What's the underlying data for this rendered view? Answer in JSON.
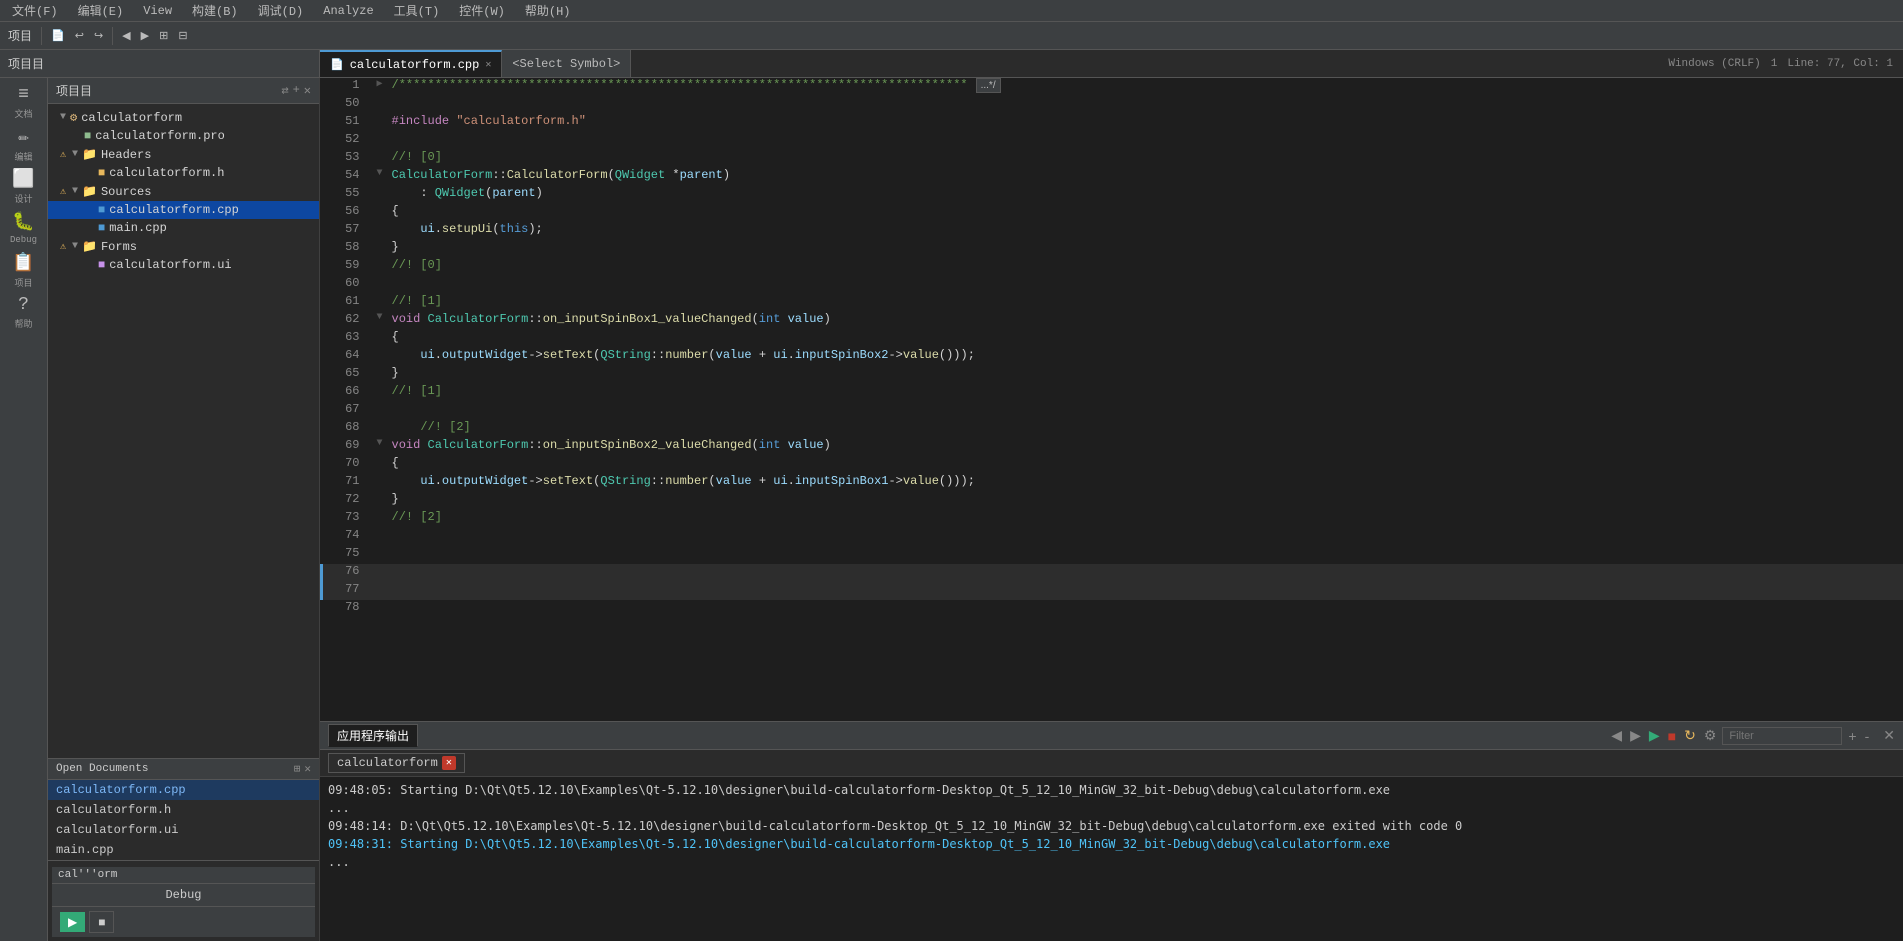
{
  "menu": {
    "items": [
      "文件(F)",
      "编辑(E)",
      "View",
      "构建(B)",
      "调试(D)",
      "Analyze",
      "工具(T)",
      "控件(W)",
      "帮助(H)"
    ]
  },
  "toolbar": {
    "project_label": "项目",
    "file_icon": "📄",
    "undo": "↩",
    "redo": "↪",
    "nav_back": "◀",
    "nav_fwd": "▶",
    "zoom_add": "⊞",
    "zoom_sub": "⊟"
  },
  "tabs": {
    "active_file": "calculatorform.cpp",
    "symbol": "<Select Symbol>",
    "breadcrumb": "calculatorform.cpp",
    "status": {
      "line_ending": "Windows (CRLF)",
      "encoding": "1",
      "line_col": "Line: 77, Col: 1"
    }
  },
  "sidebar": {
    "icons": [
      {
        "name": "edit-icon",
        "symbol": "≡",
        "label": "文档"
      },
      {
        "name": "design-icon",
        "symbol": "⬜",
        "label": "编辑"
      },
      {
        "name": "debug-icon",
        "symbol": "🐛",
        "label": "设计"
      },
      {
        "name": "project-icon",
        "symbol": "📁",
        "label": "Debug"
      },
      {
        "name": "project2-icon",
        "symbol": "📋",
        "label": "项目"
      },
      {
        "name": "help-icon",
        "symbol": "?",
        "label": "帮助"
      }
    ]
  },
  "project_tree": {
    "header": "项目目",
    "items": [
      {
        "id": "root",
        "label": "calculatorform",
        "type": "project",
        "level": 0,
        "expanded": true,
        "arrow": "▼"
      },
      {
        "id": "pro",
        "label": "calculatorform.pro",
        "type": "pro",
        "level": 1,
        "expanded": false,
        "arrow": ""
      },
      {
        "id": "headers",
        "label": "Headers",
        "type": "folder",
        "level": 1,
        "expanded": true,
        "arrow": "▼"
      },
      {
        "id": "h",
        "label": "calculatorform.h",
        "type": "h",
        "level": 2,
        "expanded": false,
        "arrow": ""
      },
      {
        "id": "sources",
        "label": "Sources",
        "type": "folder",
        "level": 1,
        "expanded": true,
        "arrow": "▼"
      },
      {
        "id": "cpp_main",
        "label": "calculatorform.cpp",
        "type": "cpp",
        "level": 2,
        "expanded": false,
        "arrow": "",
        "selected": true
      },
      {
        "id": "cpp2",
        "label": "main.cpp",
        "type": "cpp",
        "level": 2,
        "expanded": false,
        "arrow": ""
      },
      {
        "id": "forms",
        "label": "Forms",
        "type": "folder",
        "level": 1,
        "expanded": true,
        "arrow": "▼"
      },
      {
        "id": "ui",
        "label": "calculatorform.ui",
        "type": "ui",
        "level": 2,
        "expanded": false,
        "arrow": ""
      }
    ]
  },
  "open_documents": {
    "header": "Open Documents",
    "items": [
      {
        "label": "calculatorform.cpp",
        "active": true
      },
      {
        "label": "calculatorform.h",
        "active": false
      },
      {
        "label": "calculatorform.ui",
        "active": false
      },
      {
        "label": "main.cpp",
        "active": false
      }
    ]
  },
  "thumb": {
    "label": "cal'''orm",
    "debug_btn": "Debug"
  },
  "code": {
    "filename": "calculatorform.cpp",
    "lines": [
      {
        "num": 1,
        "fold": "▶",
        "text": "/*******************************************************************************",
        "has_collapse": true,
        "collapse_text": "...*/"
      },
      {
        "num": 50,
        "fold": "",
        "text": ""
      },
      {
        "num": 51,
        "fold": "",
        "text": "#include \"calculatorform.h\""
      },
      {
        "num": 52,
        "fold": "",
        "text": ""
      },
      {
        "num": 53,
        "fold": "",
        "text": "//! [0]"
      },
      {
        "num": 54,
        "fold": "▼",
        "text": "CalculatorForm::CalculatorForm(QWidget *parent)"
      },
      {
        "num": 55,
        "fold": "",
        "text": "    : QWidget(parent)"
      },
      {
        "num": 56,
        "fold": "",
        "text": "{"
      },
      {
        "num": 57,
        "fold": "",
        "text": "    ui.setupUi(this);"
      },
      {
        "num": 58,
        "fold": "",
        "text": "}"
      },
      {
        "num": 59,
        "fold": "",
        "text": "//! [0]"
      },
      {
        "num": 60,
        "fold": "",
        "text": ""
      },
      {
        "num": 61,
        "fold": "",
        "text": "//! [1]"
      },
      {
        "num": 62,
        "fold": "▼",
        "text": "void CalculatorForm::on_inputSpinBox1_valueChanged(int value)"
      },
      {
        "num": 63,
        "fold": "",
        "text": "{"
      },
      {
        "num": 64,
        "fold": "",
        "text": "    ui.outputWidget->setText(QString::number(value + ui.inputSpinBox2->value()));"
      },
      {
        "num": 65,
        "fold": "",
        "text": "}"
      },
      {
        "num": 66,
        "fold": "",
        "text": "//! [1]"
      },
      {
        "num": 67,
        "fold": "",
        "text": ""
      },
      {
        "num": 68,
        "fold": "",
        "text": "    //! [2]"
      },
      {
        "num": 69,
        "fold": "▼",
        "text": "void CalculatorForm::on_inputSpinBox2_valueChanged(int value)"
      },
      {
        "num": 70,
        "fold": "",
        "text": "{"
      },
      {
        "num": 71,
        "fold": "",
        "text": "    ui.outputWidget->setText(QString::number(value + ui.inputSpinBox1->value()));"
      },
      {
        "num": 72,
        "fold": "",
        "text": "}"
      },
      {
        "num": 73,
        "fold": "",
        "text": "//! [2]"
      },
      {
        "num": 74,
        "fold": "",
        "text": ""
      },
      {
        "num": 75,
        "fold": "",
        "text": ""
      },
      {
        "num": 76,
        "fold": "",
        "text": "",
        "current": true
      },
      {
        "num": 77,
        "fold": "",
        "text": "",
        "current": true
      },
      {
        "num": 78,
        "fold": "",
        "text": ""
      }
    ]
  },
  "bottom_panel": {
    "tab_label": "应用程序输出",
    "active_tab": "calculatorform",
    "filter_placeholder": "Filter",
    "output_lines": [
      {
        "text": "09:48:05: Starting D:\\Qt\\Qt5.12.10\\Examples\\Qt-5.12.10\\designer\\build-calculatorform-Desktop_Qt_5_12_10_MinGW_32_bit-Debug\\debug\\calculatorform.exe",
        "type": "info"
      },
      {
        "text": "...",
        "type": "info"
      },
      {
        "text": "09:48:14: D:\\Qt\\Qt5.12.10\\Examples\\Qt-5.12.10\\designer\\build-calculatorform-Desktop_Qt_5_12_10_MinGW_32_bit-Debug\\debug\\calculatorform.exe exited with code 0",
        "type": "success"
      },
      {
        "text": "",
        "type": "info"
      },
      {
        "text": "09:48:31: Starting D:\\Qt\\Qt5.12.10\\Examples\\Qt-5.12.10\\designer\\build-calculatorform-Desktop_Qt_5_12_10_MinGW_32_bit-Debug\\debug\\calculatorform.exe",
        "type": "link"
      },
      {
        "text": "...",
        "type": "info"
      }
    ]
  }
}
